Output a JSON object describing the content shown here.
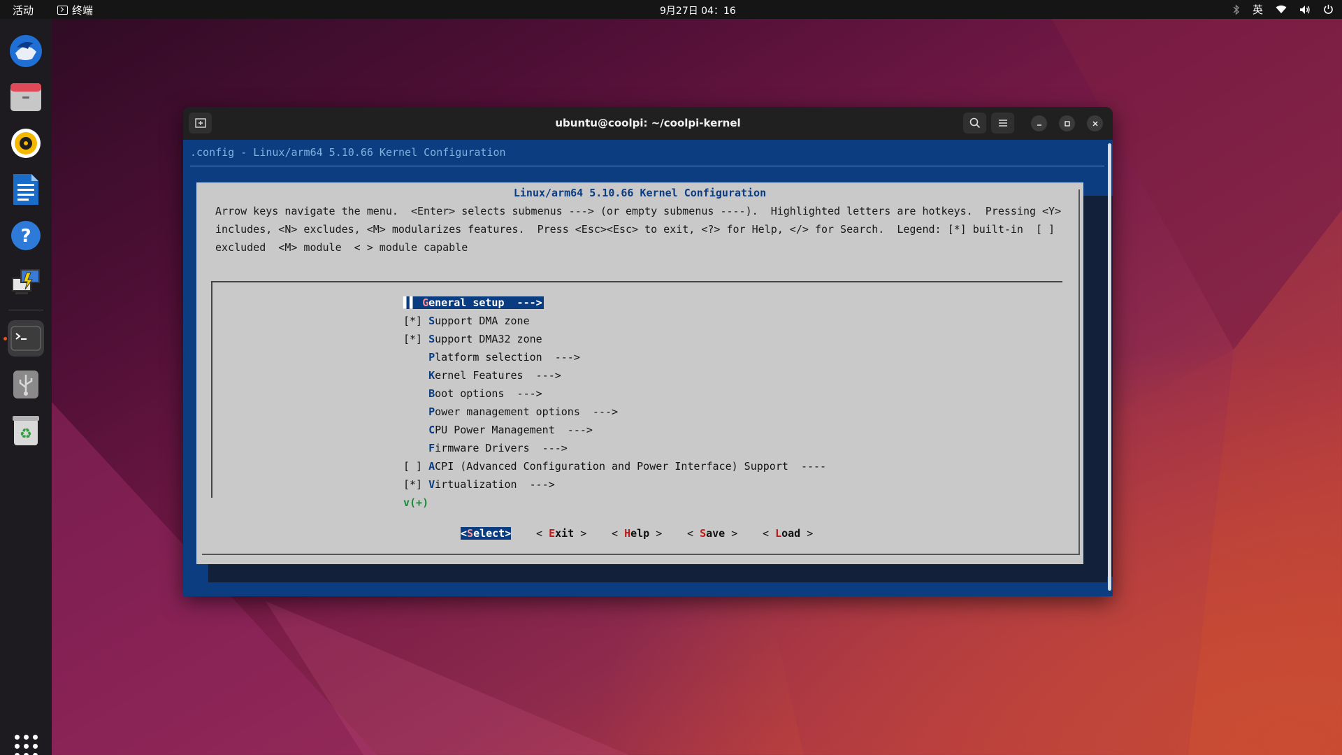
{
  "topbar": {
    "activities": "活动",
    "app_name": "终端",
    "clock": "9月27日 04：16",
    "input_method": "英"
  },
  "dock": {
    "items": [
      "thunderbird-icon",
      "files-icon",
      "rhythmbox-icon",
      "writer-icon",
      "help-icon",
      "remote-desktop-icon",
      "terminal-icon",
      "usb-icon",
      "trash-icon"
    ]
  },
  "window": {
    "title": "ubuntu@coolpi: ~/coolpi-kernel"
  },
  "terminal": {
    "header": ".config - Linux/arm64 5.10.66 Kernel Configuration",
    "dialog_title": "Linux/arm64 5.10.66 Kernel Configuration",
    "instructions": [
      "Arrow keys navigate the menu.  <Enter> selects submenus ---> (or empty submenus ----).  Highlighted letters are hotkeys.  Pressing <Y>",
      "includes, <N> excludes, <M> modularizes features.  Press <Esc><Esc> to exit, <?> for Help, </> for Search.  Legend: [*] built-in  [ ]",
      "excluded  <M> module  < > module capable"
    ],
    "menu": [
      {
        "prefix": "   ",
        "hotkey": "G",
        "rest": "eneral setup  --->",
        "selected": true
      },
      {
        "prefix": "[*] ",
        "hotkey": "S",
        "rest": "upport DMA zone",
        "selected": false
      },
      {
        "prefix": "[*] ",
        "hotkey": "S",
        "rest": "upport DMA32 zone",
        "selected": false
      },
      {
        "prefix": "    ",
        "hotkey": "P",
        "rest": "latform selection  --->",
        "selected": false
      },
      {
        "prefix": "    ",
        "hotkey": "K",
        "rest": "ernel Features  --->",
        "selected": false
      },
      {
        "prefix": "    ",
        "hotkey": "B",
        "rest": "oot options  --->",
        "selected": false
      },
      {
        "prefix": "    ",
        "hotkey": "P",
        "rest": "ower management options  --->",
        "selected": false
      },
      {
        "prefix": "    ",
        "hotkey": "C",
        "rest": "PU Power Management  --->",
        "selected": false
      },
      {
        "prefix": "    ",
        "hotkey": "F",
        "rest": "irmware Drivers  --->",
        "selected": false
      },
      {
        "prefix": "[ ] ",
        "hotkey": "A",
        "rest": "CPI (Advanced Configuration and Power Interface) Support  ----",
        "selected": false
      },
      {
        "prefix": "[*] ",
        "hotkey": "V",
        "rest": "irtualization  --->",
        "selected": false
      }
    ],
    "more_indicator": "v(+)",
    "buttons": [
      {
        "pre": "<",
        "hotkey": "S",
        "rest": "elect",
        "post": ">",
        "selected": true
      },
      {
        "pre": "< ",
        "hotkey": "E",
        "rest": "xit",
        "post": " >",
        "selected": false
      },
      {
        "pre": "< ",
        "hotkey": "H",
        "rest": "elp",
        "post": " >",
        "selected": false
      },
      {
        "pre": "< ",
        "hotkey": "S",
        "rest": "ave",
        "post": " >",
        "selected": false
      },
      {
        "pre": "< ",
        "hotkey": "L",
        "rest": "oad",
        "post": " >",
        "selected": false
      }
    ]
  }
}
